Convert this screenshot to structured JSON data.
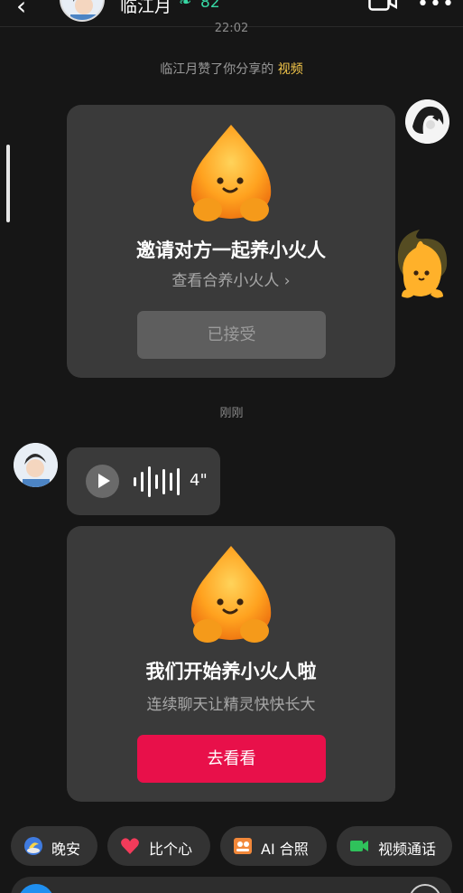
{
  "header": {
    "back_icon": "‹",
    "name": "临江月",
    "spark_icon": "spark-icon",
    "spark_count": "82",
    "more_icon": "•••"
  },
  "timestamps": {
    "top": "22:02",
    "middle": "刚刚"
  },
  "notice": {
    "text": "临江月赞了你分享的",
    "link": "视频"
  },
  "card_invite": {
    "title": "邀请对方一起养小火人",
    "subtitle": "查看合养小火人 ›",
    "button": "已接受"
  },
  "voice_message": {
    "duration": "4\""
  },
  "card_start": {
    "title": "我们开始养小火人啦",
    "subtitle": "连续聊天让精灵快快长大",
    "button": "去看看"
  },
  "quick_replies": [
    {
      "label": "晚安",
      "icon": "moon-icon"
    },
    {
      "label": "比个心",
      "icon": "heart-icon"
    },
    {
      "label": "AI 合照",
      "icon": "photo-icon"
    },
    {
      "label": "视频通话",
      "icon": "video-call-icon"
    }
  ],
  "colors": {
    "background": "#161616",
    "card": "#3a3a3a",
    "accent_button": "#e8104a",
    "notice_link": "#f6c84a",
    "spark": "#37d8a4"
  }
}
